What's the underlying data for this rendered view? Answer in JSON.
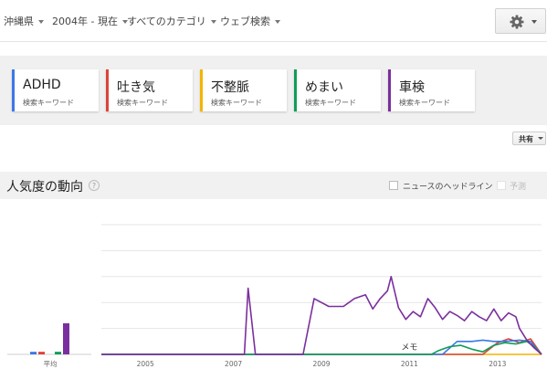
{
  "filters": [
    {
      "label": "沖縄県"
    },
    {
      "label": "2004年 - 現在"
    },
    {
      "label": "すべてのカテゴリ"
    },
    {
      "label": "ウェブ検索"
    }
  ],
  "toolbar": {
    "settings_icon": "gear-icon"
  },
  "terms": [
    {
      "name": "ADHD",
      "type": "検索キーワード",
      "color": "#3b78e7"
    },
    {
      "name": "吐き気",
      "type": "検索キーワード",
      "color": "#db4437"
    },
    {
      "name": "不整脈",
      "type": "検索キーワード",
      "color": "#f4b400"
    },
    {
      "name": "めまい",
      "type": "検索キーワード",
      "color": "#0f9d58"
    },
    {
      "name": "車検",
      "type": "検索キーワード",
      "color": "#7b2f9e"
    }
  ],
  "share": {
    "label": "共有"
  },
  "interest": {
    "title": "人気度の動向",
    "help": "?",
    "news_label": "ニュースのヘッドライン",
    "forecast_label": "予測"
  },
  "chart_data": {
    "type": "line",
    "x_start": "2004-01",
    "x_end": "2014-01",
    "ylim": [
      0,
      100
    ],
    "grid": true,
    "x_ticks": [
      "2005",
      "2007",
      "2009",
      "2011",
      "2013"
    ],
    "average_label": "平均",
    "memo_label": "メモ",
    "averages": [
      {
        "name": "ADHD",
        "value": 2
      },
      {
        "name": "吐き気",
        "value": 2
      },
      {
        "name": "不整脈",
        "value": 0
      },
      {
        "name": "めまい",
        "value": 2
      },
      {
        "name": "車検",
        "value": 24
      }
    ],
    "series": [
      {
        "name": "車検",
        "color": "#7b2f9e",
        "points": [
          [
            "2004-01",
            0
          ],
          [
            "2007-02",
            0
          ],
          [
            "2007-04",
            0
          ],
          [
            "2007-05",
            51
          ],
          [
            "2007-07",
            0
          ],
          [
            "2008-08",
            0
          ],
          [
            "2008-11",
            43
          ],
          [
            "2009-03",
            37
          ],
          [
            "2009-07",
            37
          ],
          [
            "2009-10",
            43
          ],
          [
            "2010-01",
            46
          ],
          [
            "2010-03",
            35
          ],
          [
            "2010-05",
            43
          ],
          [
            "2010-07",
            49
          ],
          [
            "2010-08",
            60
          ],
          [
            "2010-10",
            36
          ],
          [
            "2010-12",
            27
          ],
          [
            "2011-02",
            33
          ],
          [
            "2011-04",
            29
          ],
          [
            "2011-06",
            43
          ],
          [
            "2011-08",
            36
          ],
          [
            "2011-10",
            27
          ],
          [
            "2011-12",
            33
          ],
          [
            "2012-02",
            30
          ],
          [
            "2012-04",
            26
          ],
          [
            "2012-06",
            33
          ],
          [
            "2012-08",
            29
          ],
          [
            "2012-10",
            26
          ],
          [
            "2012-12",
            35
          ],
          [
            "2013-02",
            26
          ],
          [
            "2013-04",
            32
          ],
          [
            "2013-06",
            29
          ],
          [
            "2013-07",
            20
          ],
          [
            "2013-09",
            11
          ],
          [
            "2013-11",
            5
          ],
          [
            "2014-01",
            0
          ]
        ]
      },
      {
        "name": "めまい",
        "color": "#0f9d58",
        "points": [
          [
            "2004-01",
            0
          ],
          [
            "2011-07",
            0
          ],
          [
            "2011-09",
            3
          ],
          [
            "2011-12",
            6
          ],
          [
            "2012-03",
            7
          ],
          [
            "2012-06",
            4
          ],
          [
            "2012-09",
            2
          ],
          [
            "2012-12",
            7
          ],
          [
            "2013-03",
            9
          ],
          [
            "2013-06",
            8
          ],
          [
            "2013-09",
            10
          ],
          [
            "2013-11",
            6
          ],
          [
            "2014-01",
            0
          ]
        ]
      },
      {
        "name": "ADHD",
        "color": "#3b78e7",
        "points": [
          [
            "2004-01",
            0
          ],
          [
            "2011-10",
            0
          ],
          [
            "2012-02",
            10
          ],
          [
            "2012-06",
            10
          ],
          [
            "2012-09",
            11
          ],
          [
            "2012-12",
            10
          ],
          [
            "2013-03",
            10
          ],
          [
            "2013-07",
            11
          ],
          [
            "2013-10",
            10
          ],
          [
            "2014-01",
            0
          ]
        ]
      },
      {
        "name": "吐き気",
        "color": "#db4437",
        "points": [
          [
            "2004-01",
            0
          ],
          [
            "2012-09",
            0
          ],
          [
            "2013-01",
            9
          ],
          [
            "2013-04",
            12
          ],
          [
            "2013-07",
            9
          ],
          [
            "2013-10",
            12
          ],
          [
            "2014-01",
            0
          ]
        ]
      },
      {
        "name": "不整脈",
        "color": "#f4b400",
        "points": [
          [
            "2004-01",
            0
          ],
          [
            "2014-01",
            0
          ]
        ]
      }
    ]
  }
}
